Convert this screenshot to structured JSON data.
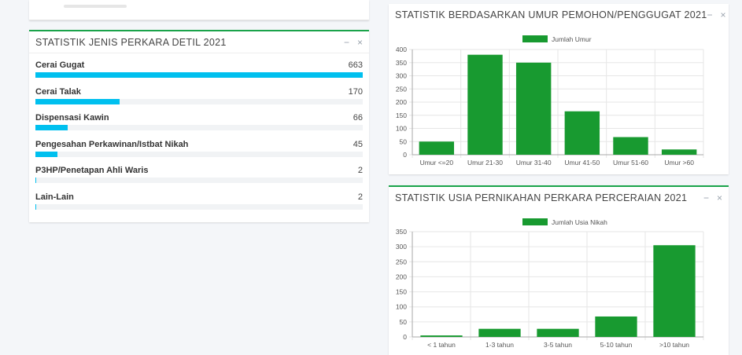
{
  "left_panel": {
    "title": "STATISTIK JENIS PERKARA DETIL 2021",
    "minimize": "−",
    "close": "×",
    "accent": "#00c0ef",
    "max_value": 663,
    "items": [
      {
        "name": "Cerai Gugat",
        "count": "663",
        "value": 663
      },
      {
        "name": "Cerai Talak",
        "count": "170",
        "value": 170
      },
      {
        "name": "Dispensasi Kawin",
        "count": "66",
        "value": 66
      },
      {
        "name": "Pengesahan Perkawinan/Istbat Nikah",
        "count": "45",
        "value": 45
      },
      {
        "name": "P3HP/Penetapan Ahli Waris",
        "count": "2",
        "value": 2
      },
      {
        "name": "Lain-Lain",
        "count": "2",
        "value": 2
      }
    ]
  },
  "age_panel": {
    "title": "STATISTIK BERDASARKAN UMUR PEMOHON/PENGGUGAT 2021",
    "minimize": "−",
    "close": "×"
  },
  "marriage_panel": {
    "title": "STATISTIK USIA PERNIKAHAN PERKARA PERCERAIAN 2021",
    "minimize": "−",
    "close": "×"
  },
  "chart_data": [
    {
      "type": "bar",
      "legend_position": "top",
      "grid": true,
      "color": "#189a30",
      "categories": [
        "Umur <=20",
        "Umur 21-30",
        "Umur 31-40",
        "Umur 41-50",
        "Umur 51-60",
        "Umur >60"
      ],
      "series": [
        {
          "name": "Jumlah Umur",
          "values": [
            50,
            380,
            350,
            165,
            67,
            20
          ]
        }
      ],
      "ylim": [
        0,
        400
      ],
      "yticks": [
        0,
        50,
        100,
        150,
        200,
        250,
        300,
        350,
        400
      ]
    },
    {
      "type": "bar",
      "legend_position": "top",
      "grid": true,
      "color": "#189a30",
      "categories": [
        "< 1 tahun",
        "1-3 tahun",
        "3-5 tahun",
        "5-10 tahun",
        ">10 tahun"
      ],
      "series": [
        {
          "name": "Jumlah Usia  Nikah",
          "values": [
            5,
            27,
            27,
            68,
            305
          ]
        }
      ],
      "ylim": [
        0,
        350
      ],
      "yticks": [
        0,
        50,
        100,
        150,
        200,
        250,
        300,
        350
      ]
    }
  ]
}
